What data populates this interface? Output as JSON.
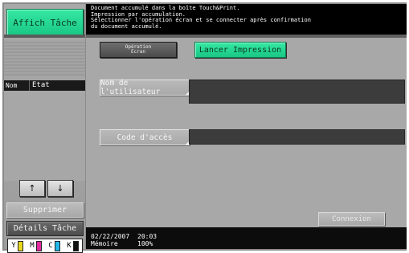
{
  "left_panel": {
    "affich_button": "Affich Tâche",
    "columns": {
      "user": "Nom Utilis",
      "state": "Etat"
    },
    "scroll_up_label": "↑",
    "scroll_down_label": "↓",
    "supprimer_button": "Supprimer",
    "details_button": "Détails Tâche",
    "toner": [
      {
        "letter": "Y",
        "color": "#e8d820"
      },
      {
        "letter": "M",
        "color": "#e02a9e"
      },
      {
        "letter": "C",
        "color": "#22b7e8"
      },
      {
        "letter": "K",
        "color": "#111111"
      }
    ]
  },
  "message": {
    "lines": [
      "Document accumulé dans la boîte Touch&Print.",
      "Impression par accumulation.",
      "Sélectionner l'opération écran et se connecter après confirmation",
      "du document accumulé."
    ]
  },
  "main": {
    "operation_button": {
      "line1": "Opération",
      "line2": "Ecran"
    },
    "lancer_button": "Lancer Impression",
    "user_label": "Nom de l'utilisateur",
    "user_value": "",
    "code_label": "Code d'accès",
    "code_value": "",
    "connexion_button": "Connexion"
  },
  "status_bar": {
    "date": "02/22/2007",
    "time": "20:03",
    "memory_label": "Mémoire",
    "memory_value": "100%"
  },
  "colors": {
    "accent_green": "#22d08f",
    "panel_gray": "#a8a8a8",
    "message_bg": "#000000"
  }
}
